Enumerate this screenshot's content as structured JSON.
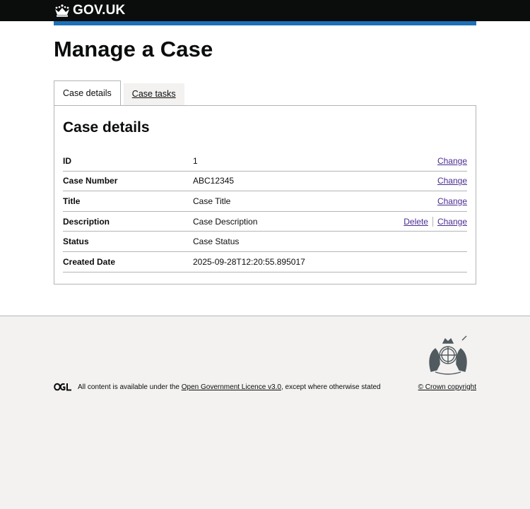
{
  "header": {
    "logo_text": "GOV.UK",
    "logo_icon": "crown-icon"
  },
  "page": {
    "title": "Manage a Case"
  },
  "tabs": [
    {
      "label": "Case details",
      "active": true
    },
    {
      "label": "Case tasks",
      "active": false
    }
  ],
  "case_details": {
    "heading": "Case details",
    "rows": [
      {
        "key": "ID",
        "value": "1",
        "actions": [
          "Change"
        ]
      },
      {
        "key": "Case Number",
        "value": "ABC12345",
        "actions": [
          "Change"
        ]
      },
      {
        "key": "Title",
        "value": "Case Title",
        "actions": [
          "Change"
        ]
      },
      {
        "key": "Description",
        "value": "Case Description",
        "actions": [
          "Delete",
          "Change"
        ]
      },
      {
        "key": "Status",
        "value": "Case Status",
        "actions": []
      },
      {
        "key": "Created Date",
        "value": "2025-09-28T12:20:55.895017",
        "actions": []
      }
    ]
  },
  "footer": {
    "ogl_icon": "ogl-logo-icon",
    "crest_icon": "royal-coat-of-arms-icon",
    "licence_prefix": "All content is available under the ",
    "licence_link": "Open Government Licence v3.0",
    "licence_suffix": ", except where otherwise stated",
    "copyright": "© Crown copyright"
  },
  "colors": {
    "header_bg": "#0b0c0c",
    "brand_blue": "#1d70b8",
    "link_visited": "#4c2c92",
    "border": "#b1b4b6",
    "footer_bg": "#f3f2f1"
  }
}
